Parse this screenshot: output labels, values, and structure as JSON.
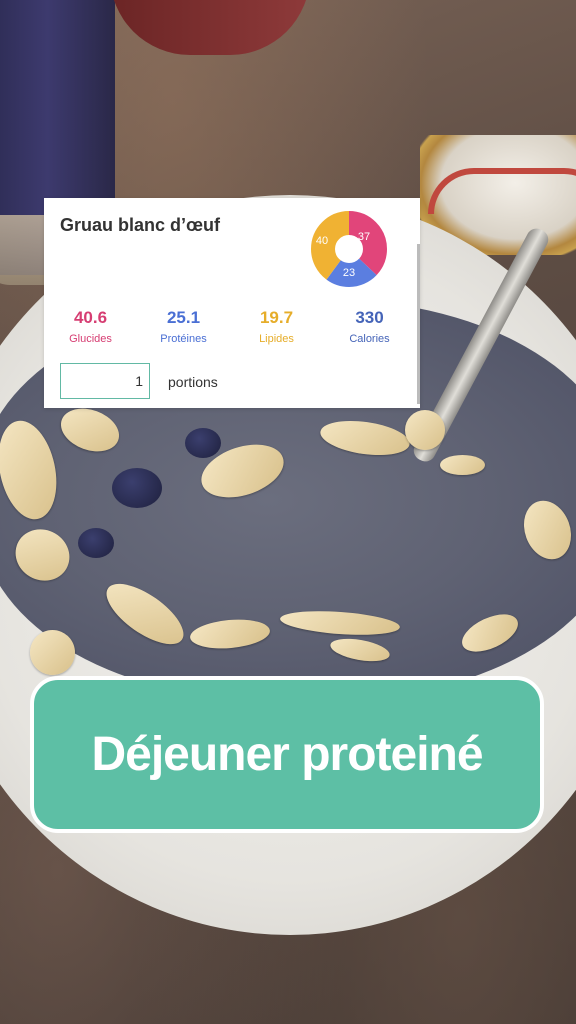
{
  "recipe_card": {
    "title": "Gruau blanc d’œuf",
    "donut": {
      "glucides_label": "37",
      "proteines_label": "23",
      "lipides_label": "40",
      "colors": {
        "glucides": "#e1457a",
        "proteines": "#5b7ee0",
        "lipides": "#f0b233"
      }
    },
    "macros": [
      {
        "value": "40.6",
        "label": "Glucides",
        "color": "#d63d72"
      },
      {
        "value": "25.1",
        "label": "Protéines",
        "color": "#4a6fd4"
      },
      {
        "value": "19.7",
        "label": "Lipides",
        "color": "#e6ad2a"
      },
      {
        "value": "330",
        "label": "Calories",
        "color": "#4564b8"
      }
    ],
    "servings": {
      "value": "1",
      "unit_label": "portions"
    }
  },
  "caption": {
    "text": "Déjeuner proteiné",
    "bubble_color": "#5dbfa5"
  }
}
